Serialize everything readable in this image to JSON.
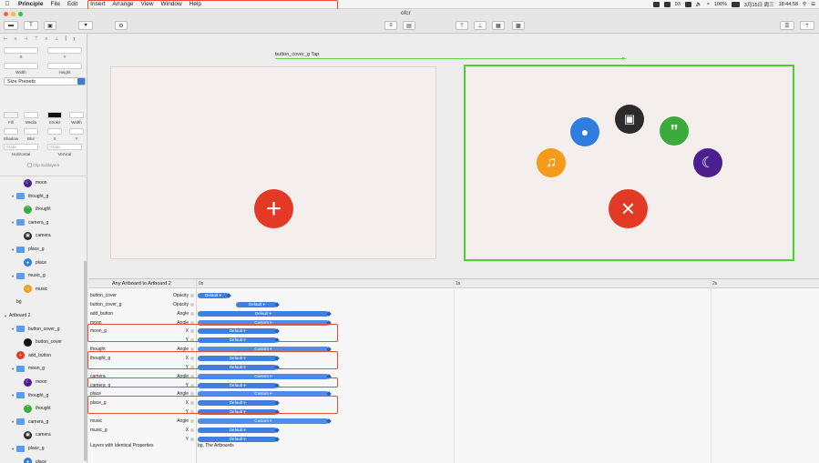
{
  "menubar": {
    "app": "Principle",
    "items": [
      "File",
      "Edit",
      "Insert",
      "Arrange",
      "View",
      "Window",
      "Help"
    ],
    "status": {
      "battery": "100%",
      "date": "3月15日 周三",
      "time": "18:44:58",
      "notif_count": "93"
    }
  },
  "window": {
    "filename": "ofcr"
  },
  "toolbar": {
    "left_buttons": [
      "▬",
      "T",
      "▣",
      "♥",
      "⚙"
    ],
    "right_buttons": [
      "☰",
      "⇡"
    ]
  },
  "inspector": {
    "x_label": "X",
    "y_label": "Y",
    "width_label": "Width",
    "height_label": "Height",
    "size_presets": "Size Presets",
    "fill": "Fill",
    "media": "Media",
    "stroke": "Stroke",
    "stroke_width": "Width",
    "shadow": "Shadow",
    "blur": "Blur",
    "static_h": "Static",
    "static_v": "Static",
    "horizontal": "Horizontal",
    "vertical": "Vertical",
    "clip_sublayers": "Clip Sublayers"
  },
  "layers": [
    {
      "name": "moon",
      "indent": 2,
      "icon": "moon",
      "color": "#4b1f8f"
    },
    {
      "name": "thought_g",
      "indent": 1,
      "icon": "folder"
    },
    {
      "name": "thought",
      "indent": 2,
      "icon": "quote",
      "color": "#3caa3c"
    },
    {
      "name": "camera_g",
      "indent": 1,
      "icon": "folder"
    },
    {
      "name": "camera",
      "indent": 2,
      "icon": "camera",
      "color": "#2b2b2b"
    },
    {
      "name": "place_g",
      "indent": 1,
      "icon": "folder"
    },
    {
      "name": "place",
      "indent": 2,
      "icon": "pin",
      "color": "#2f7de0"
    },
    {
      "name": "music_g",
      "indent": 1,
      "icon": "folder"
    },
    {
      "name": "music",
      "indent": 2,
      "icon": "note",
      "color": "#f59a1b"
    },
    {
      "name": "bg",
      "indent": 1,
      "icon": "none"
    },
    {
      "name": "Artboard 2",
      "indent": 0,
      "icon": "none"
    },
    {
      "name": "button_cover_g",
      "indent": 1,
      "icon": "folder"
    },
    {
      "name": "button_cover",
      "indent": 2,
      "icon": "dark",
      "color": "#111111"
    },
    {
      "name": "add_button",
      "indent": 1,
      "icon": "plus",
      "color": "#e23a24"
    },
    {
      "name": "moon_g",
      "indent": 1,
      "icon": "folder"
    },
    {
      "name": "moon",
      "indent": 2,
      "icon": "moon",
      "color": "#4b1f8f"
    },
    {
      "name": "thought_g",
      "indent": 1,
      "icon": "folder"
    },
    {
      "name": "thought",
      "indent": 2,
      "icon": "quote",
      "color": "#3caa3c"
    },
    {
      "name": "camera_g",
      "indent": 1,
      "icon": "folder"
    },
    {
      "name": "camera",
      "indent": 2,
      "icon": "camera",
      "color": "#2b2b2b"
    },
    {
      "name": "place_g",
      "indent": 1,
      "icon": "folder"
    },
    {
      "name": "place",
      "indent": 2,
      "icon": "pin",
      "color": "#2f7de0"
    }
  ],
  "canvas": {
    "trigger_label": "button_cover_g Tap",
    "artboard2": {
      "border": "#4bd12c"
    }
  },
  "timeline": {
    "title": "Any Artboard to Artboard 2",
    "ticks": [
      "0s",
      "1s",
      "2s"
    ],
    "rows": [
      {
        "name": "button_cover",
        "prop": "Opacity",
        "label": "Default ▾",
        "kind": "default",
        "start": 0.0,
        "end": 0.12
      },
      {
        "name": "button_cover_g",
        "prop": "Opacity",
        "label": "Default ▾",
        "kind": "default",
        "start": 0.15,
        "end": 0.31
      },
      {
        "name": "add_button",
        "prop": "Angle",
        "label": "Default ▾",
        "kind": "default",
        "start": 0.0,
        "end": 0.51
      },
      {
        "name": "moon",
        "prop": "Angle",
        "label": "Custom ▾",
        "kind": "custom",
        "start": 0.0,
        "end": 0.51
      },
      {
        "name": "moon_g",
        "prop": "X",
        "label": "Default ▾",
        "kind": "default",
        "start": 0.0,
        "end": 0.31
      },
      {
        "name": "",
        "prop": "Y",
        "label": "Default ▾",
        "kind": "default",
        "start": 0.0,
        "end": 0.31
      },
      {
        "name": "thought",
        "prop": "Angle",
        "label": "Custom ▾",
        "kind": "custom",
        "start": 0.0,
        "end": 0.51
      },
      {
        "name": "thought_g",
        "prop": "X",
        "label": "Default ▾",
        "kind": "default",
        "start": 0.0,
        "end": 0.31
      },
      {
        "name": "",
        "prop": "Y",
        "label": "Default ▾",
        "kind": "default",
        "start": 0.0,
        "end": 0.31
      },
      {
        "name": "camera",
        "prop": "Angle",
        "label": "Custom ▾",
        "kind": "custom",
        "start": 0.0,
        "end": 0.51
      },
      {
        "name": "camera_g",
        "prop": "Y",
        "label": "Default ▾",
        "kind": "default",
        "start": 0.0,
        "end": 0.31
      },
      {
        "name": "place",
        "prop": "Angle",
        "label": "Custom ▾",
        "kind": "custom",
        "start": 0.0,
        "end": 0.51
      },
      {
        "name": "place_g",
        "prop": "X",
        "label": "Default ▾",
        "kind": "default",
        "start": 0.0,
        "end": 0.31
      },
      {
        "name": "",
        "prop": "Y",
        "label": "Default ▾",
        "kind": "default",
        "start": 0.0,
        "end": 0.31
      },
      {
        "name": "music",
        "prop": "Angle",
        "label": "Custom ▾",
        "kind": "custom",
        "start": 0.0,
        "end": 0.51
      },
      {
        "name": "music_g",
        "prop": "X",
        "label": "Default ▾",
        "kind": "default",
        "start": 0.0,
        "end": 0.31
      },
      {
        "name": "",
        "prop": "Y",
        "label": "Default ▾",
        "kind": "default",
        "start": 0.0,
        "end": 0.31
      }
    ],
    "identical_label": "Layers with Identical Properties",
    "identical_value": "bg, The Artboards"
  },
  "colors": {
    "highlight": "#e0503a",
    "add": "#e23a24",
    "pin": "#2f7de0",
    "camera": "#2b2b2b",
    "quote": "#3caa3c",
    "music": "#f59a1b",
    "moon": "#4b1f8f"
  }
}
